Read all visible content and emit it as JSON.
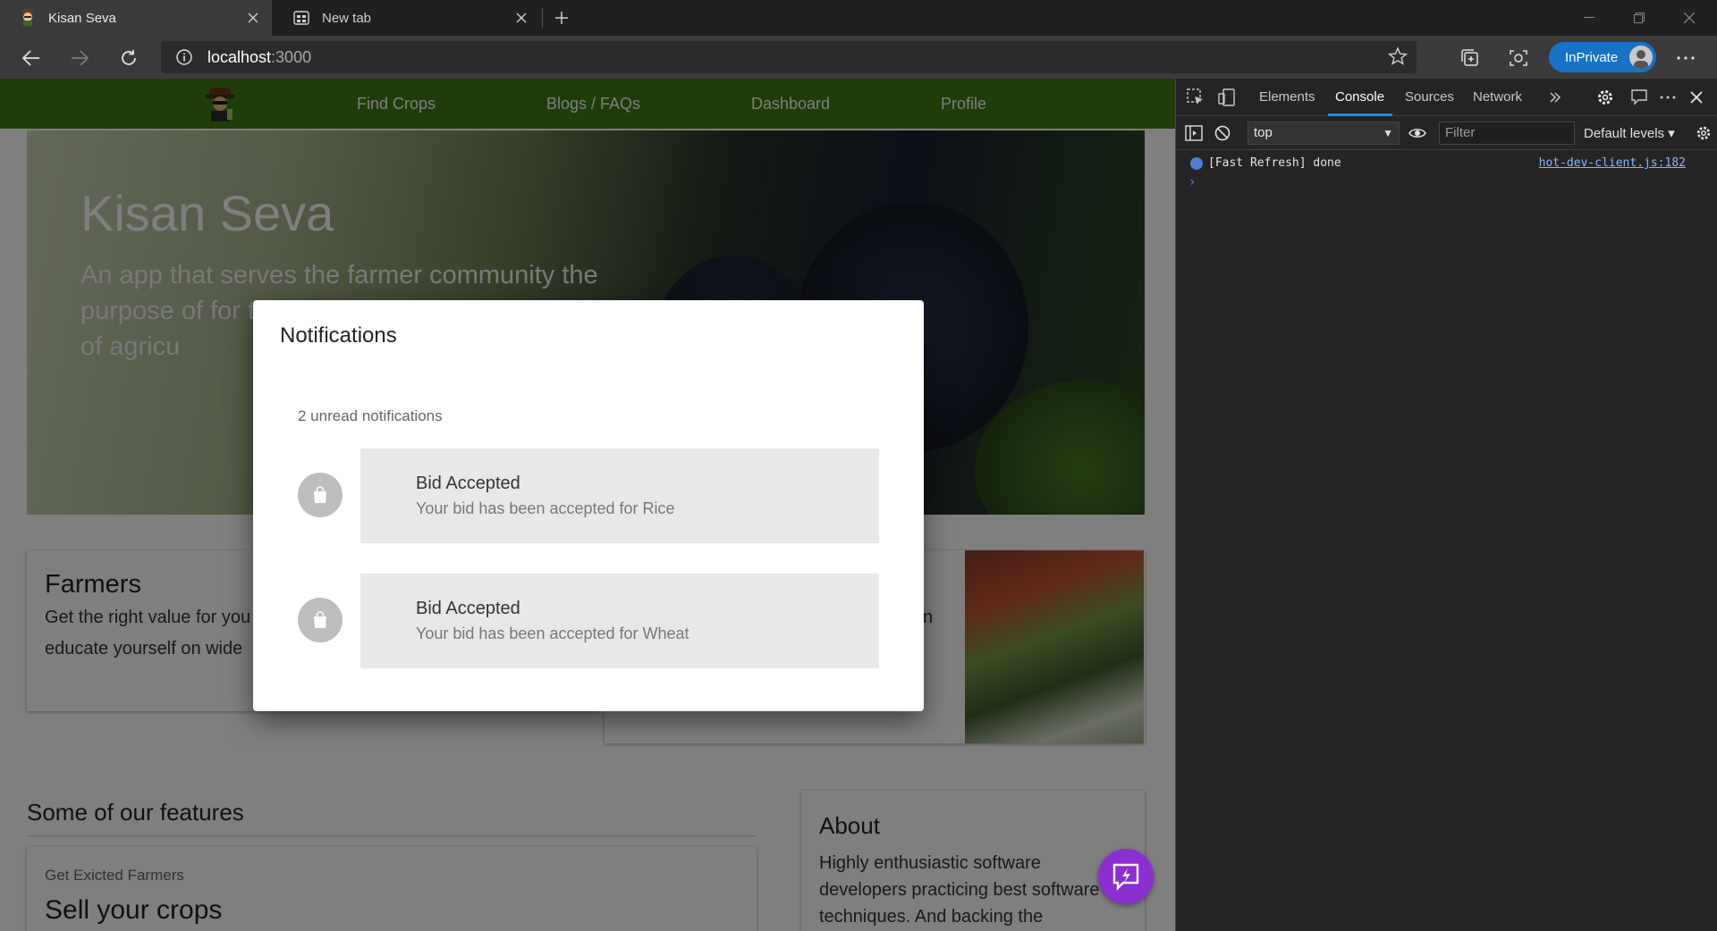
{
  "browser": {
    "tabs": [
      {
        "title": "Kisan Seva",
        "active": true
      },
      {
        "title": "New tab",
        "active": false
      }
    ],
    "url_host": "localhost",
    "url_port": ":3000",
    "inprivate_label": "InPrivate"
  },
  "app": {
    "nav": [
      "Find Crops",
      "Blogs / FAQs",
      "Dashboard",
      "Profile"
    ],
    "hero": {
      "title": "Kisan Seva",
      "subtitle_visible": "An app that serves the farmer community the purpose of for there crops best practises kinds of agricu"
    },
    "farmers_card": {
      "title": "Farmers",
      "text_line1": "Get the right value for you",
      "text_line2": "educate yourself on wide"
    },
    "right_card_fragment": "n",
    "features": {
      "section_title": "Some of our features",
      "eyebrow": "Get Exicted Farmers",
      "title": "Sell your crops"
    },
    "about": {
      "title": "About",
      "text": "Highly enthusiastic software developers practicing best software techniques. And backing the"
    }
  },
  "dialog": {
    "title": "Notifications",
    "unread": "2 unread notifications",
    "items": [
      {
        "title": "Bid Accepted",
        "text": "Your bid has been accepted for Rice",
        "icon": "shopping-bag-icon"
      },
      {
        "title": "Bid Accepted",
        "text": "Your bid has been accepted for Wheat",
        "icon": "shopping-bag-icon"
      }
    ]
  },
  "devtools": {
    "tabs": [
      "Elements",
      "Console",
      "Sources",
      "Network"
    ],
    "active_tab": "Console",
    "context": "top",
    "filter_placeholder": "Filter",
    "levels": "Default levels",
    "log": {
      "message": "[Fast Refresh] done",
      "source": "hot-dev-client.js:182"
    },
    "prompt": "›"
  },
  "colors": {
    "appbar": "#3f7a12",
    "fab": "#8c2fd0",
    "inprivate": "#1673c6",
    "devtools_accent": "#1a8cff"
  }
}
